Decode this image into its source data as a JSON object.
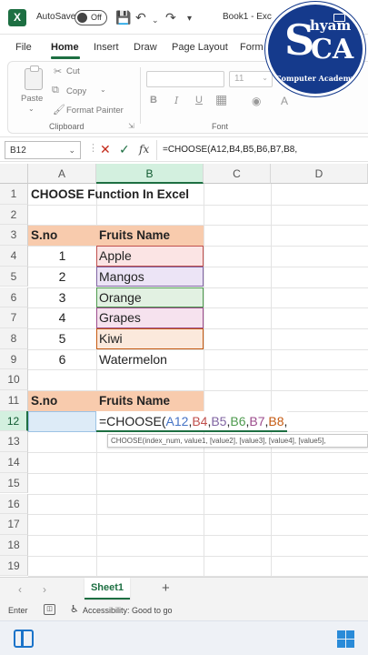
{
  "titlebar": {
    "app_icon": "X",
    "autosave_label": "AutoSave",
    "autosave_state": "Off",
    "doc_title": "Book1 - Exc"
  },
  "tabs": [
    "File",
    "Home",
    "Insert",
    "Draw",
    "Page Layout",
    "Form"
  ],
  "ribbon": {
    "paste_label": "Paste",
    "cut_label": "Cut",
    "copy_label": "Copy",
    "format_painter_label": "Format Painter",
    "clipboard_group": "Clipboard",
    "font_size": "11",
    "font_group": "Font",
    "bold": "B",
    "italic": "I",
    "underline": "U"
  },
  "formula_bar": {
    "name_box": "B12",
    "formula": "=CHOOSE(A12,B4,B5,B6,B7,B8,"
  },
  "columns": [
    "A",
    "B",
    "C",
    "D"
  ],
  "rows": [
    "1",
    "2",
    "3",
    "4",
    "5",
    "6",
    "7",
    "8",
    "9",
    "10",
    "11",
    "12",
    "13",
    "14",
    "15",
    "16",
    "17",
    "18",
    "19"
  ],
  "sheet": {
    "title": "CHOOSE Function In Excel",
    "table1_headers": [
      "S.no",
      "Fruits Name"
    ],
    "table1_rows": [
      {
        "sno": "1",
        "fruit": "Apple"
      },
      {
        "sno": "2",
        "fruit": "Mangos"
      },
      {
        "sno": "3",
        "fruit": "Orange"
      },
      {
        "sno": "4",
        "fruit": "Grapes"
      },
      {
        "sno": "5",
        "fruit": "Kiwi"
      },
      {
        "sno": "6",
        "fruit": "Watermelon"
      }
    ],
    "table2_headers": [
      "S.no",
      "Fruits Name"
    ],
    "editing_tokens": [
      "=CHOOSE(",
      "A12",
      ",",
      "B4",
      ",",
      "B5",
      ",",
      "B6",
      ",",
      "B7",
      ",",
      "B8",
      ","
    ],
    "tooltip": "CHOOSE(index_num, value1, [value2], [value3], [value4], [value5],"
  },
  "ref_colors": {
    "A12": "#4472c4",
    "B4": "#c0504d",
    "B5": "#8064a2",
    "B6": "#4e9a4e",
    "B7": "#9c4c8c",
    "B8": "#c55a11"
  },
  "sheet_tabs": [
    "Sheet1"
  ],
  "status": {
    "mode": "Enter",
    "accessibility": "Accessibility: Good to go"
  },
  "logo": {
    "letter": "S",
    "hyam": "hyam",
    "ca": "CA",
    "tagline": "Computer Academy"
  }
}
